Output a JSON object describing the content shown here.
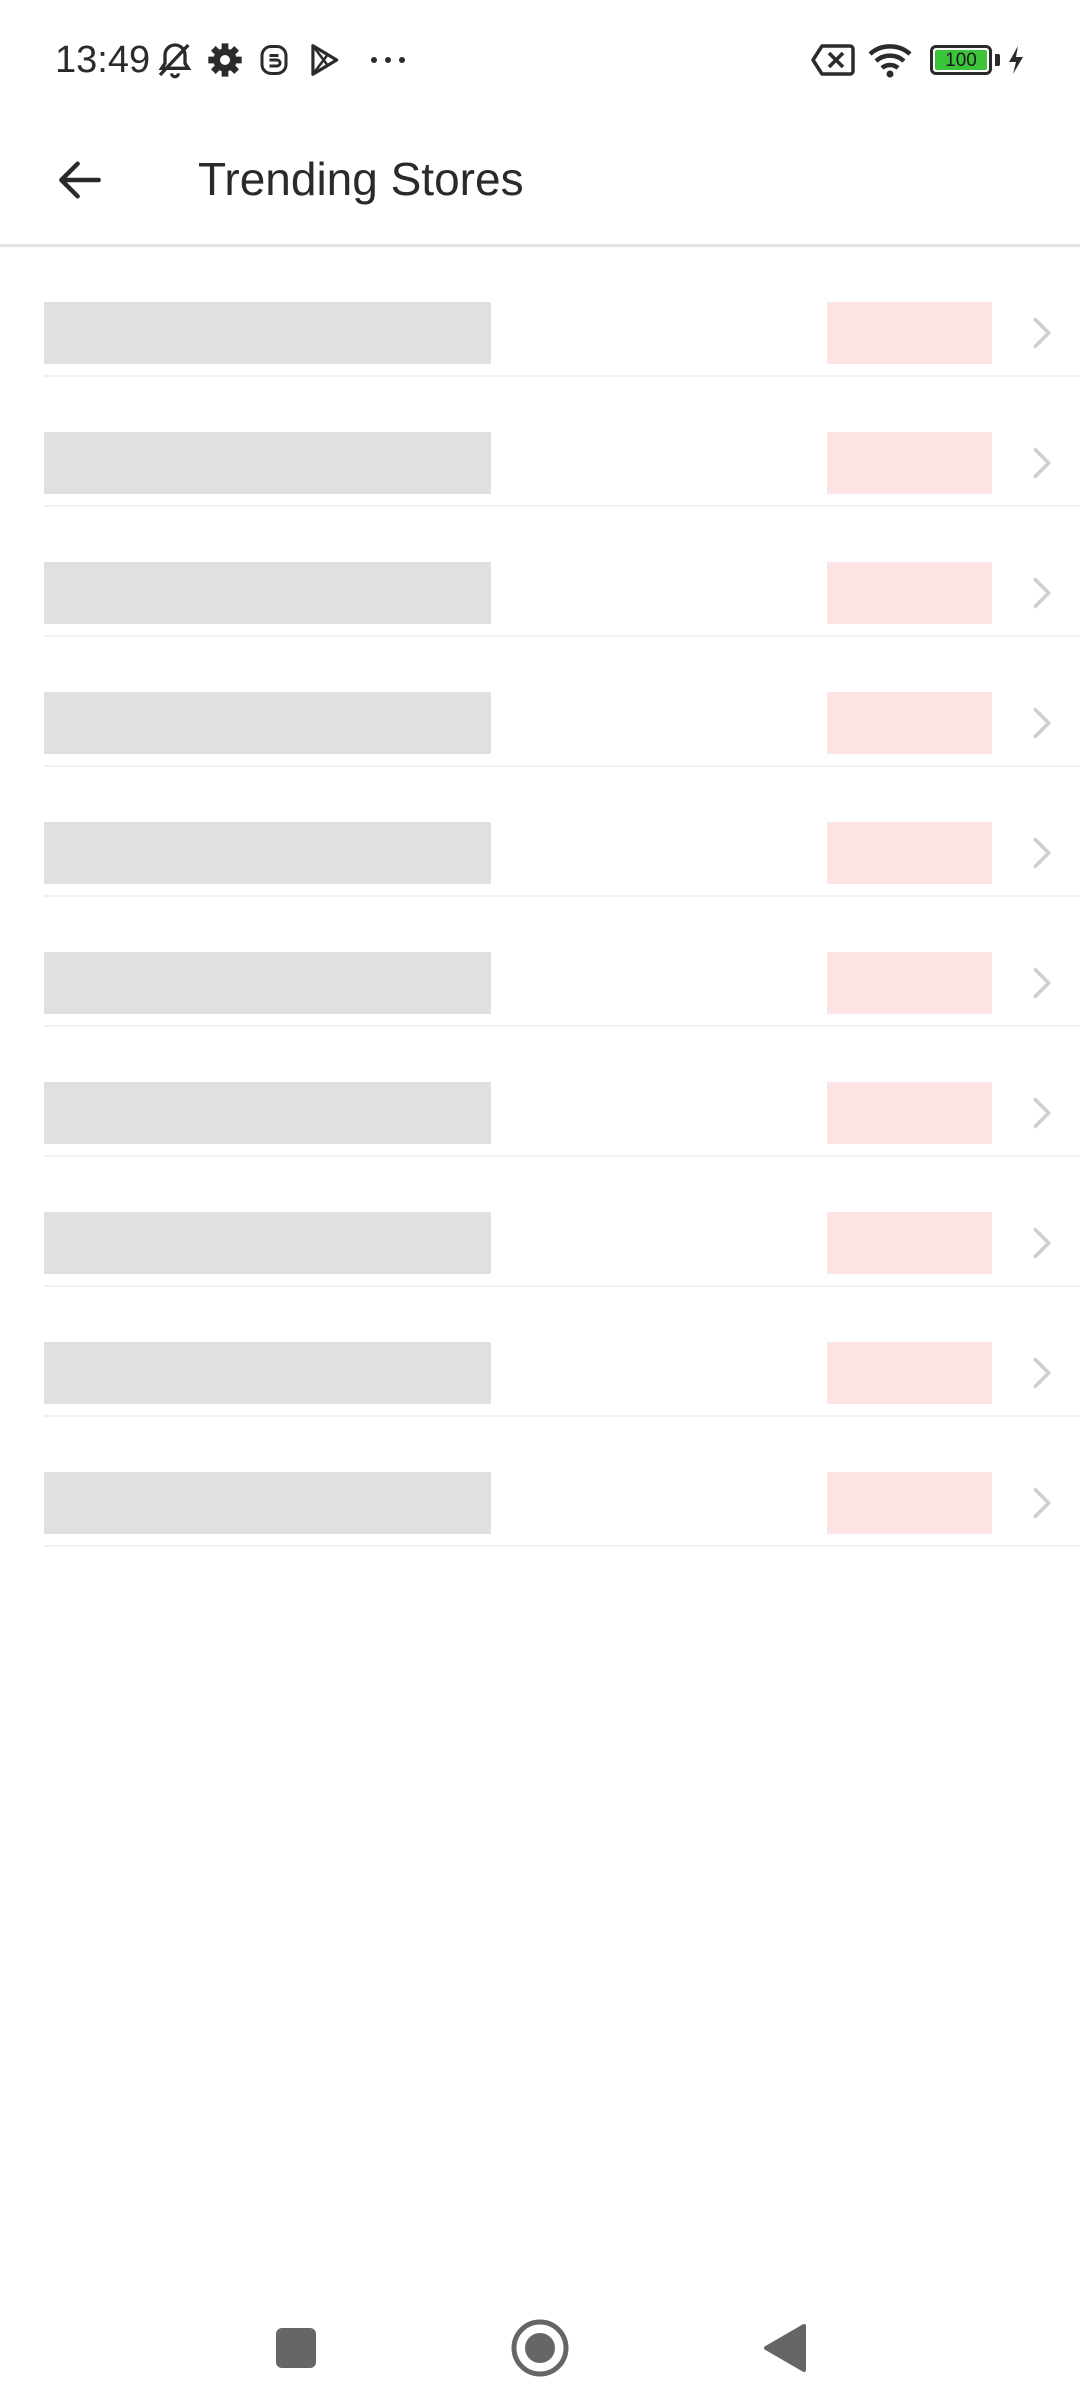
{
  "status_bar": {
    "time": "13:49",
    "icons": [
      "bell-off-icon",
      "gear-icon",
      "app-icon",
      "play-store-icon",
      "more-dots-icon",
      "no-sim-icon",
      "wifi-icon",
      "battery-icon",
      "charging-icon"
    ],
    "battery_level": "100",
    "battery_color": "#3cc33c"
  },
  "app_bar": {
    "back_icon": "arrow-left-icon",
    "title": "Trending Stores"
  },
  "store_list": {
    "state": "loading",
    "rows": [
      {
        "placeholder": "skeleton"
      },
      {
        "placeholder": "skeleton"
      },
      {
        "placeholder": "skeleton"
      },
      {
        "placeholder": "skeleton"
      },
      {
        "placeholder": "skeleton"
      },
      {
        "placeholder": "skeleton"
      },
      {
        "placeholder": "skeleton"
      },
      {
        "placeholder": "skeleton"
      },
      {
        "placeholder": "skeleton"
      },
      {
        "placeholder": "skeleton"
      }
    ],
    "name_skeleton_color": "#e0e0e0",
    "badge_skeleton_color": "#fde4e4"
  },
  "nav_bar": {
    "buttons": [
      "recents-square-icon",
      "home-circle-icon",
      "back-triangle-icon"
    ]
  }
}
